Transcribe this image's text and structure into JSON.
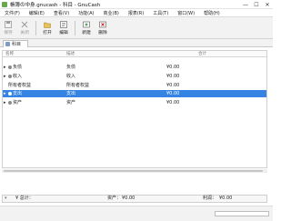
{
  "window": {
    "title": "帳簿の中身.gnucash - 科目 - GnuCash",
    "minimize": "—",
    "maximize": "☐",
    "close": "✕"
  },
  "menu": [
    "文件(F)",
    "编辑(E)",
    "查看(V)",
    "功能(A)",
    "商业(B)",
    "报表(R)",
    "工具(T)",
    "窗口(W)",
    "帮助(H)"
  ],
  "toolbar": {
    "save": "保存",
    "close": "关闭",
    "open": "打开",
    "edit": "编辑",
    "new": "新建",
    "delete": "删除"
  },
  "tab": {
    "label": "科目"
  },
  "columns": {
    "name": "名称",
    "description": "描述",
    "total": "合计"
  },
  "accounts": [
    {
      "name": "负债",
      "description": "负债",
      "total": "¥0.00",
      "selected": false
    },
    {
      "name": "收入",
      "description": "收入",
      "total": "¥0.00",
      "selected": false
    },
    {
      "name": "所有者权益",
      "description": "所有者权益",
      "total": "¥0.00",
      "selected": false
    },
    {
      "name": "支出",
      "description": "支出",
      "total": "¥0.00",
      "selected": true
    },
    {
      "name": "资产",
      "description": "资产",
      "total": "¥0.00",
      "selected": false
    }
  ],
  "summary": {
    "total_label": "¥ 总计：",
    "assets_label": "资产：",
    "assets_value": "¥0.00",
    "profit_label": "利润：",
    "profit_value": "¥0.00"
  },
  "colors": {
    "selection": "#3584e4"
  }
}
